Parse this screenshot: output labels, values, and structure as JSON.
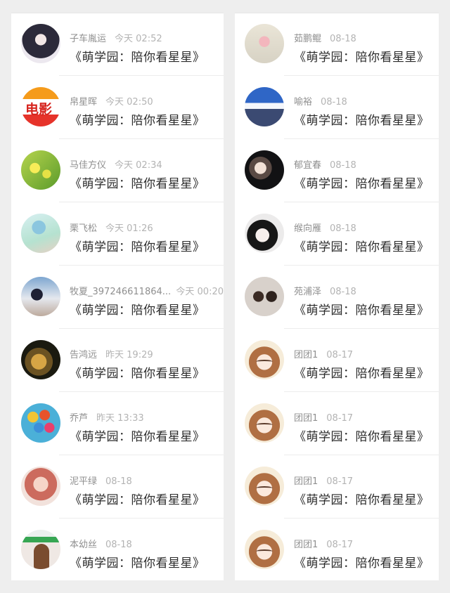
{
  "left": [
    {
      "name": "子车胤运",
      "time": "今天 02:52",
      "message": "《萌学园：陪你看星星》",
      "avatar_icon": "girl-dark-avatar"
    },
    {
      "name": "帛星晖",
      "time": "今天 02:50",
      "message": "《萌学园：陪你看星星》",
      "avatar_icon": "movie-logo-avatar",
      "avatar_text": "电影"
    },
    {
      "name": "马佳方仪",
      "time": "今天 02:34",
      "message": "《萌学园：陪你看星星》",
      "avatar_icon": "flowers-avatar"
    },
    {
      "name": "栗飞松",
      "time": "今天 01:26",
      "message": "《萌学园：陪你看星星》",
      "avatar_icon": "umbrella-avatar"
    },
    {
      "name": "牧夏_397246611864...",
      "time": "今天 00:20",
      "message": "《萌学园：陪你看星星》",
      "avatar_icon": "couple-avatar"
    },
    {
      "name": "告鸿远",
      "time": "昨天 19:29",
      "message": "《萌学园：陪你看星星》",
      "avatar_icon": "gold-ornament-avatar"
    },
    {
      "name": "乔芦",
      "time": "昨天 13:33",
      "message": "《萌学园：陪你看星星》",
      "avatar_icon": "balloons-avatar"
    },
    {
      "name": "泥平绿",
      "time": "08-18",
      "message": "《萌学园：陪你看星星》",
      "avatar_icon": "horse-avatar"
    },
    {
      "name": "本幼丝",
      "time": "08-18",
      "message": "《萌学园：陪你看星星》",
      "avatar_icon": "singer-avatar"
    }
  ],
  "right": [
    {
      "name": "茹鹏鲲",
      "time": "08-18",
      "message": "《萌学园：陪你看星星》",
      "avatar_icon": "rose-avatar"
    },
    {
      "name": "喻裕",
      "time": "08-18",
      "message": "《萌学园：陪你看星星》",
      "avatar_icon": "snow-mountain-avatar"
    },
    {
      "name": "郁宜春",
      "time": "08-18",
      "message": "《萌学园：陪你看星星》",
      "avatar_icon": "dark-portrait-avatar"
    },
    {
      "name": "缑向雁",
      "time": "08-18",
      "message": "《萌学园：陪你看星星》",
      "avatar_icon": "bw-girl-avatar"
    },
    {
      "name": "苑浦泽",
      "time": "08-18",
      "message": "《萌学园：陪你看星星》",
      "avatar_icon": "kids-avatar"
    },
    {
      "name": "团团1",
      "time": "08-17",
      "message": "《萌学园：陪你看星星》",
      "avatar_icon": "anime-girl-avatar"
    },
    {
      "name": "团团1",
      "time": "08-17",
      "message": "《萌学园：陪你看星星》",
      "avatar_icon": "anime-girl-avatar"
    },
    {
      "name": "团团1",
      "time": "08-17",
      "message": "《萌学园：陪你看星星》",
      "avatar_icon": "anime-girl-avatar"
    },
    {
      "name": "团团1",
      "time": "08-17",
      "message": "《萌学园：陪你看星星》",
      "avatar_icon": "anime-girl-avatar"
    }
  ]
}
